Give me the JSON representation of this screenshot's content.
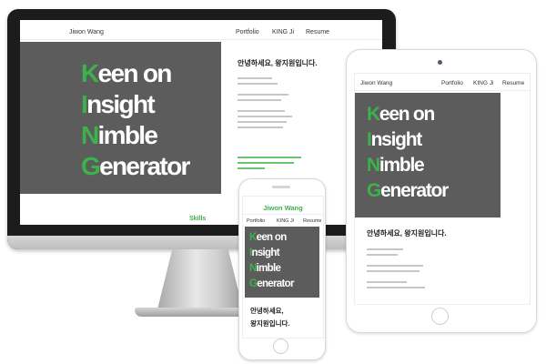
{
  "site": {
    "brand": "Jiwon Wang",
    "nav": [
      "Portfolio",
      "KING Ji",
      "Resume"
    ],
    "hero_lines": [
      {
        "cap": "K",
        "rest": "een on"
      },
      {
        "cap": "I",
        "rest": "nsight"
      },
      {
        "cap": "N",
        "rest": "imble"
      },
      {
        "cap": "G",
        "rest": "enerator"
      }
    ],
    "greeting": "안녕하세요, 왕지원입니다.",
    "greeting_phone_1": "안녕하세요,",
    "greeting_phone_2": "왕지원입니다.",
    "skills_label": "Skills"
  },
  "colors": {
    "accent": "#3cb24a",
    "hero_bg": "#5c5c5c",
    "monitor_bezel": "#1c1c1c"
  }
}
